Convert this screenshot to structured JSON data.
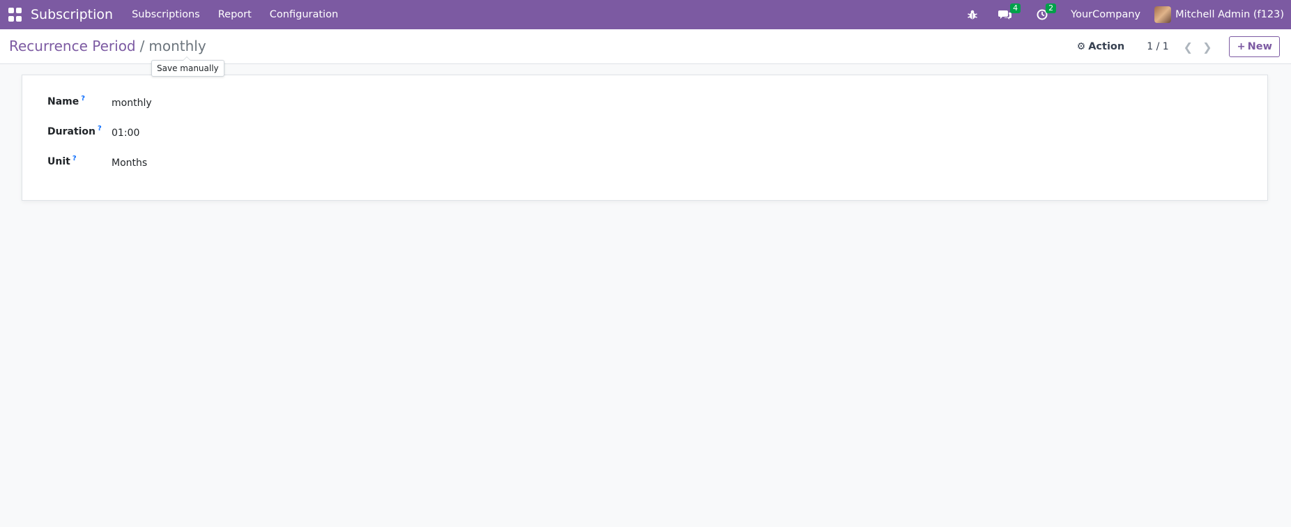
{
  "navbar": {
    "app_title": "Subscription",
    "menu": [
      {
        "label": "Subscriptions"
      },
      {
        "label": "Report"
      },
      {
        "label": "Configuration"
      }
    ],
    "messages_badge": "4",
    "activities_badge": "2",
    "company": "YourCompany",
    "user_name": "Mitchell Admin (f123)",
    "accent_color": "#7c5aa2",
    "badge_color": "#00a04a"
  },
  "breadcrumb": {
    "parent": "Recurrence Period",
    "separator": "/",
    "current": "monthly"
  },
  "tooltip": {
    "text": "Save manually"
  },
  "control": {
    "action_label": "Action",
    "pager": "1 / 1",
    "new_label": "New"
  },
  "form": {
    "fields": [
      {
        "label": "Name",
        "help": "?",
        "value": "monthly"
      },
      {
        "label": "Duration",
        "help": "?",
        "value": "01:00"
      },
      {
        "label": "Unit",
        "help": "?",
        "value": "Months"
      }
    ]
  }
}
